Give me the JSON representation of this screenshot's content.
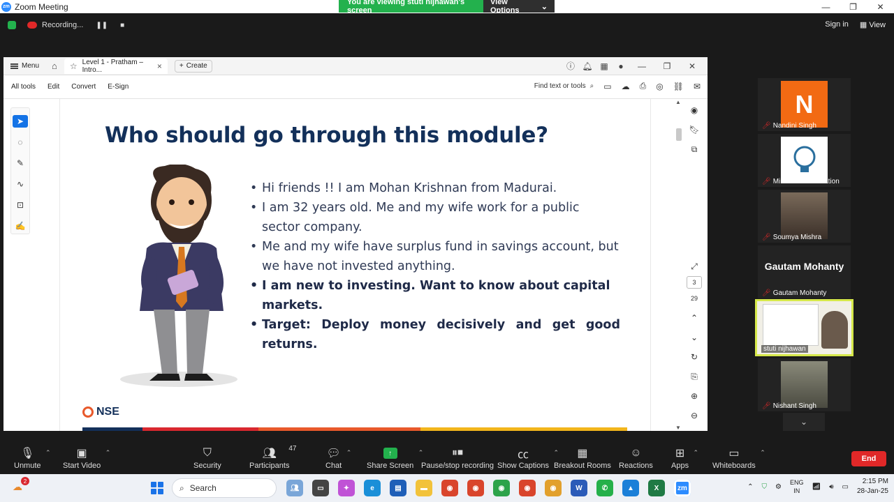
{
  "zoom": {
    "window_title": "Zoom Meeting",
    "logo_text": "zm",
    "share_banner": "You are viewing stuti nijhawan's screen",
    "view_options": "View Options",
    "recording_label": "Recording...",
    "sign_in": "Sign in",
    "view": "View"
  },
  "acrobat": {
    "menu_label": "Menu",
    "tab_title": "Level 1 - Pratham – Intro...",
    "create_label": "Create",
    "toolbar": [
      "All tools",
      "Edit",
      "Convert",
      "E-Sign"
    ],
    "find_placeholder": "Find text or tools",
    "page_current": "3",
    "page_total": "29"
  },
  "slide": {
    "title": "Who should go through this module?",
    "bullets": [
      "Hi friends !! I am Mohan Krishnan from Madurai.",
      "I am 32 years old. Me and my wife work for a public sector company.",
      "Me and my wife have surplus fund in savings account, but we have not invested anything.",
      "I am new to investing. Want to know about capital markets.",
      "Target: Deploy money decisively and get good returns."
    ],
    "logo_text": "NSE",
    "stripe_colors": [
      "#13305a",
      "#d9282f",
      "#e8592b",
      "#f2b51c"
    ]
  },
  "participants": [
    {
      "name": "Nandini Singh",
      "initial": "N",
      "avatar_color": "#f26a13"
    },
    {
      "name": "MindClub Foundation"
    },
    {
      "name": "Soumya Mishra"
    },
    {
      "name": "Gautam Mohanty",
      "display_big": "Gautam Mohanty"
    },
    {
      "name": "stuti nijhawan"
    },
    {
      "name": "Nishant Singh"
    }
  ],
  "controls": {
    "unmute": "Unmute",
    "start_video": "Start Video",
    "security": "Security",
    "participants": "Participants",
    "participant_count": "47",
    "chat": "Chat",
    "share_screen": "Share Screen",
    "pause_recording": "Pause/stop recording",
    "show_captions": "Show Captions",
    "breakout_rooms": "Breakout Rooms",
    "reactions": "Reactions",
    "apps": "Apps",
    "whiteboards": "Whiteboards",
    "end": "End"
  },
  "taskbar": {
    "notification_count": "2",
    "search_placeholder": "Search",
    "lang_top": "ENG",
    "lang_bottom": "IN",
    "time": "2:15 PM",
    "date": "28-Jan-25"
  }
}
